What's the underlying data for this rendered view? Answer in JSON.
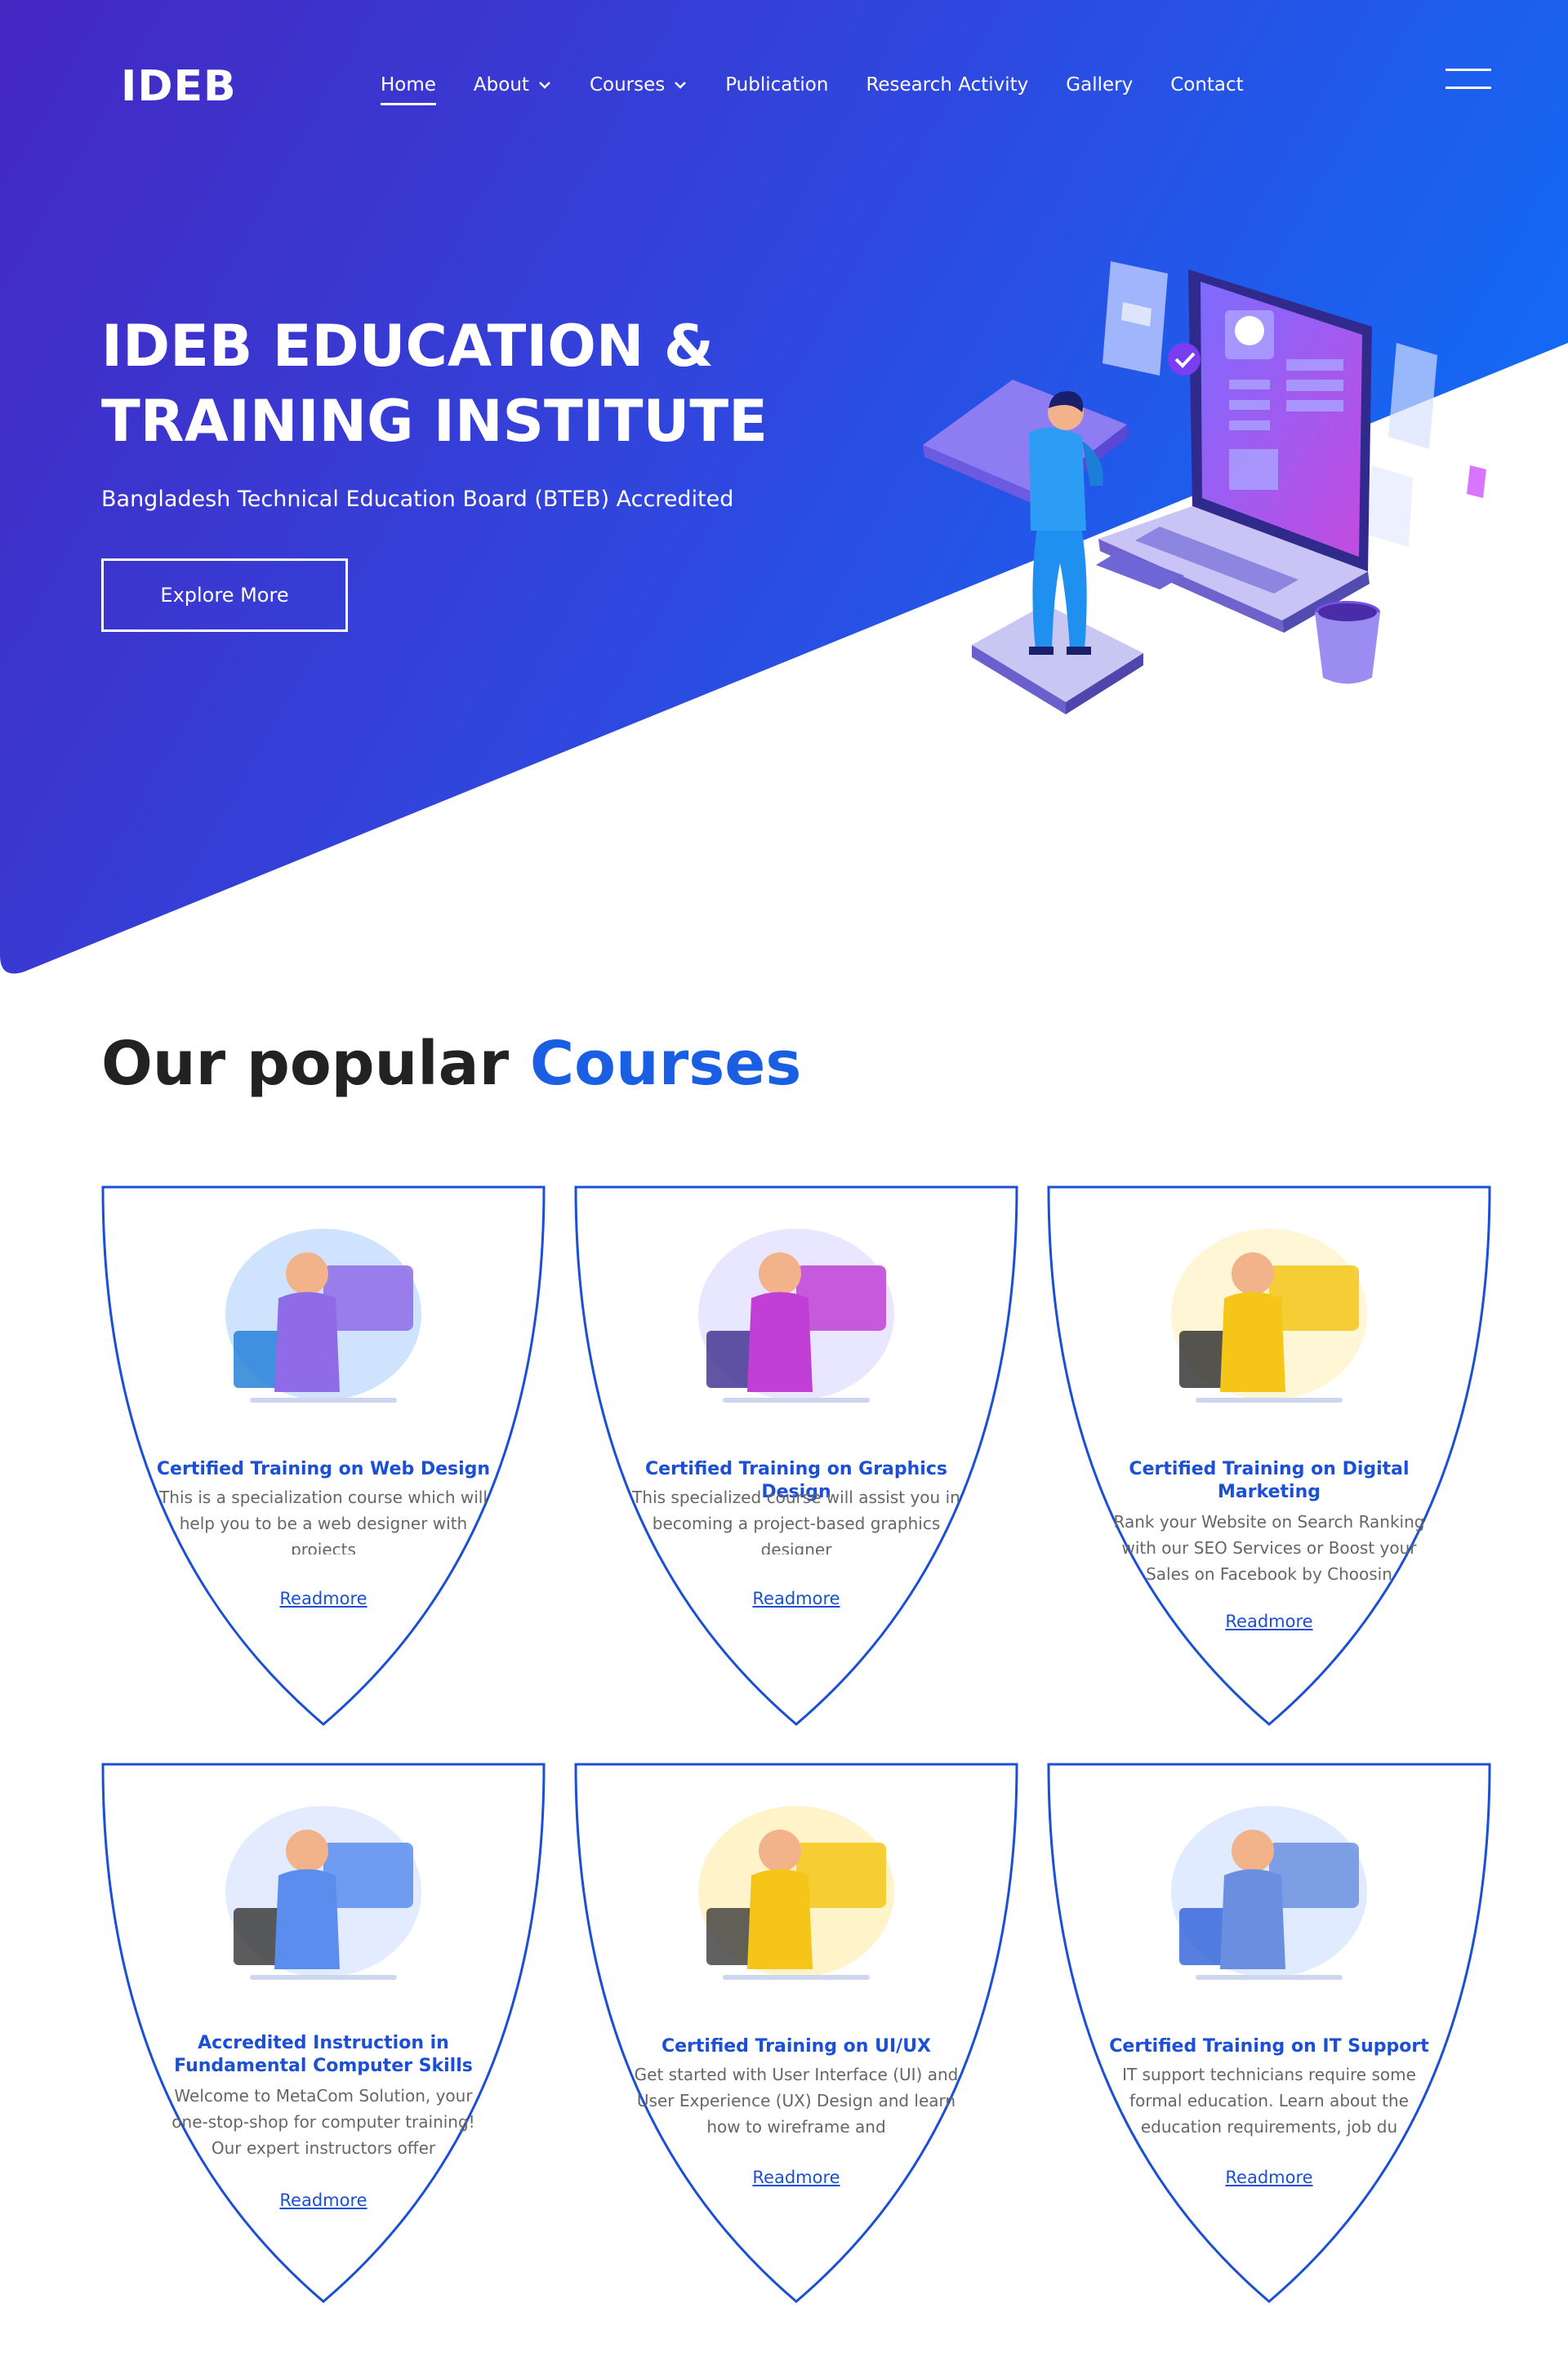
{
  "brand": {
    "logo_text": "IDEB"
  },
  "nav": {
    "items": [
      {
        "label": "Home",
        "active": true,
        "dropdown": false
      },
      {
        "label": "About",
        "active": false,
        "dropdown": true
      },
      {
        "label": "Courses",
        "active": false,
        "dropdown": true
      },
      {
        "label": "Publication",
        "active": false,
        "dropdown": false
      },
      {
        "label": "Research Activity",
        "active": false,
        "dropdown": false
      },
      {
        "label": "Gallery",
        "active": false,
        "dropdown": false
      },
      {
        "label": "Contact",
        "active": false,
        "dropdown": false
      }
    ],
    "menu_icon": "hamburger-icon"
  },
  "hero": {
    "title_line1": "IDEB EDUCATION &",
    "title_line2": "TRAINING INSTITUTE",
    "subtitle": "Bangladesh Technical Education Board (BTEB) Accredited",
    "button_label": "Explore More"
  },
  "courses": {
    "heading_plain": "Our popular ",
    "heading_accent": "Courses",
    "readmore_label": "Readmore",
    "items": [
      {
        "title": "Certified Training on Web Design",
        "description": "This is a specialization course which will help you to be a web designer with projects"
      },
      {
        "title": "Certified Training on Graphics Design",
        "description": "This specialized course will assist you in becoming a project-based graphics designer"
      },
      {
        "title": "Certified Training on Digital Marketing",
        "description": "Rank your Website on Search Ranking with our SEO Services or Boost your Sales on Facebook by Choosin"
      },
      {
        "title": "Accredited Instruction in Fundamental Computer Skills",
        "description": "Welcome to MetaCom Solution, your one-stop-shop for computer training! Our expert instructors offer"
      },
      {
        "title": "Certified Training on UI/UX",
        "description": "Get started with User Interface (UI) and User Experience (UX) Design and learn how to wireframe and"
      },
      {
        "title": "Certified Training on IT Support",
        "description": "IT support technicians require some formal education. Learn about the education requirements, job du"
      }
    ]
  },
  "colors": {
    "hero_gradient_start": "#4527c2",
    "hero_gradient_end": "#1469f5",
    "accent": "#1a5fe3",
    "card_border": "#1a4fd6"
  }
}
